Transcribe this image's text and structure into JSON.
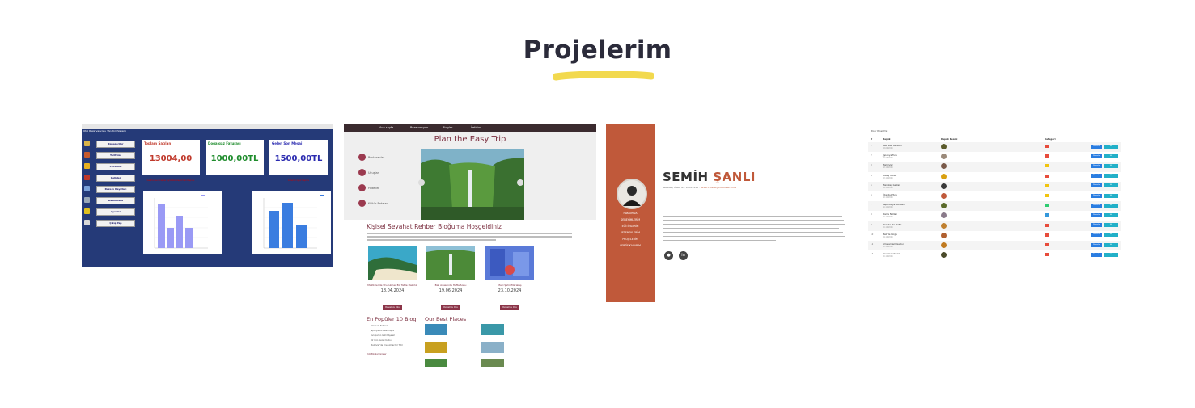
{
  "section": {
    "title": "Projelerim",
    "accent_color": "#f2d94e"
  },
  "project1": {
    "window_title": "Dashboard",
    "app_title": "Otel Rezervasyonu Yönetim Sistemi",
    "menu": [
      "Kategoriler",
      "Tarifeler",
      "Personel",
      "Gelirler",
      "Rezerv Kayıtları",
      "Dashboard",
      "Ayarlar",
      "Çıkış Yap"
    ],
    "cards": [
      {
        "title": "Toplam Satılan",
        "value": "13004,00",
        "color": "#c0392b"
      },
      {
        "title": "Doğalgaz Faturası",
        "value": "1000,00TL",
        "color": "#1e8c2c"
      },
      {
        "title": "Gelen Son Mesaj",
        "value": "1500,00TL",
        "color": "#2b2bb0"
      }
    ],
    "card_notes": [
      "Gelirler ve Giderler Aylık Karşılaştırmalı Raporu",
      "Giderler Aylık Raporu"
    ],
    "chart_legend": [
      "Gelir Raporu",
      "Giderler"
    ]
  },
  "project2": {
    "nav": [
      "Ana sayfa",
      "Rezervasyon",
      "Bloglar",
      "İletişim"
    ],
    "hero_title": "Plan the Easy Trip",
    "side_menu": [
      "Restoranlar",
      "Uçuşlar",
      "Hoteller",
      "Kültür Rotaları"
    ],
    "welcome": "Kişisel Seyahat Rehber Bloğuma Hoşgeldiniz",
    "posts": [
      {
        "title": "Maldivler'de Unutulmaz Bir Tatile Hazırlık",
        "date": "18.04.2024"
      },
      {
        "title": "Bali Adası'nda Hafta Sonu",
        "date": "19.06.2024"
      },
      {
        "title": "Mavi Şehir Marakeş",
        "date": "23.10.2024"
      }
    ],
    "post_button": "Devamını Oku",
    "popular_title": "En Popüler 10 Blog",
    "popular_items": [
      "Bali Gezi Rehberi",
      "Japonya'da Neler Yapılır",
      "Avrupa'nın Gizli Köşeleri",
      "Bir Gün Kuzey Kutbu",
      "Maldivler'de Unutulmaz Bir Tatil"
    ],
    "popular_more": "Tüm Blogları Göster",
    "best_title": "Our Best Places"
  },
  "project3": {
    "nav": [
      "HAKKIMDA",
      "DENEYİMLERİM",
      "EĞİTİMLERİM",
      "YETENEKLERİM",
      "PROJELERİM",
      "SERTİFİKALARIM"
    ],
    "first_name": "SEMİH",
    "last_name": "ŞANLI",
    "contact_prefix": "ADALAR/TÜRKİYE · 05555555 ·",
    "contact_email": "SEMIH.SANLI@EXAMPLE.COM",
    "social": [
      "github-icon",
      "linkedin-icon"
    ]
  },
  "project4": {
    "title": "Blog Yönetimi",
    "columns": [
      "Başlık",
      "Kapak Resmi",
      "Kategori"
    ],
    "rows": [
      {
        "n": "1",
        "title": "Bali Gezi Rehberi",
        "date": "18.04.2024",
        "badge": "#e74c3c",
        "img": "#5a5a2a"
      },
      {
        "n": "2",
        "title": "Japonya Turu",
        "date": "19.06.2024",
        "badge": "#e74c3c",
        "img": "#9b8a7a"
      },
      {
        "n": "3",
        "title": "Maldivler",
        "date": "23.10.2024",
        "badge": "#f1c40f",
        "img": "#7a5a4a"
      },
      {
        "n": "4",
        "title": "Kuzey Kutbu",
        "date": "02.11.2024",
        "badge": "#e74c3c",
        "img": "#d9a010"
      },
      {
        "n": "5",
        "title": "Marakeş Gezisi",
        "date": "14.11.2024",
        "badge": "#f1c40f",
        "img": "#3a3a3a"
      },
      {
        "n": "6",
        "title": "İstanbul Turu",
        "date": "20.11.2024",
        "badge": "#f1c40f",
        "img": "#c0593a"
      },
      {
        "n": "7",
        "title": "Kapadokya Rehberi",
        "date": "25.11.2024",
        "badge": "#2ecc71",
        "img": "#5a6a2a"
      },
      {
        "n": "8",
        "title": "Roma Notları",
        "date": "01.12.2024",
        "badge": "#3498db",
        "img": "#8a7a8a"
      },
      {
        "n": "9",
        "title": "Paris'te Bir Hafta",
        "date": "05.12.2024",
        "badge": "#e74c3c",
        "img": "#c08030"
      },
      {
        "n": "10",
        "title": "Bali'de Doğa",
        "date": "09.12.2024",
        "badge": "#e74c3c",
        "img": "#b06030"
      },
      {
        "n": "11",
        "title": "Amsterdam Gezisi",
        "date": "12.12.2024",
        "badge": "#e74c3c",
        "img": "#c07a20"
      },
      {
        "n": "12",
        "title": "Londra Rehberi",
        "date": "15.12.2024",
        "badge": "#e74c3c",
        "img": "#4a4a2a"
      }
    ],
    "edit_label": "Düzenle",
    "delete_label": "Sil"
  }
}
